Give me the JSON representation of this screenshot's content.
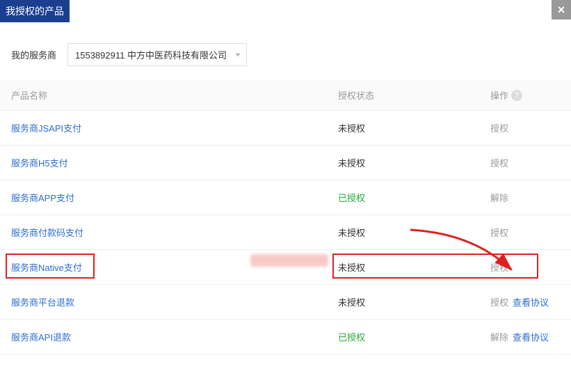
{
  "header": {
    "title": "我授权的产品"
  },
  "filter": {
    "label": "我的服务商",
    "selected": "1553892911 中方中医药科技有限公司"
  },
  "table": {
    "headers": {
      "name": "产品名称",
      "status": "授权状态",
      "action": "操作"
    },
    "help": "?",
    "rows": [
      {
        "name": "服务商JSAPI支付",
        "status": "未授权",
        "status_ok": false,
        "action": "授权",
        "view": ""
      },
      {
        "name": "服务商H5支付",
        "status": "未授权",
        "status_ok": false,
        "action": "授权",
        "view": ""
      },
      {
        "name": "服务商APP支付",
        "status": "已授权",
        "status_ok": true,
        "action": "解除",
        "view": ""
      },
      {
        "name": "服务商付款码支付",
        "status": "未授权",
        "status_ok": false,
        "action": "授权",
        "view": ""
      },
      {
        "name": "服务商Native支付",
        "status": "未授权",
        "status_ok": false,
        "action": "授权",
        "view": "",
        "highlight": true,
        "pink": true
      },
      {
        "name": "服务商平台退款",
        "status": "未授权",
        "status_ok": false,
        "action": "授权",
        "view": "查看协议"
      },
      {
        "name": "服务商API退款",
        "status": "已授权",
        "status_ok": true,
        "action": "解除",
        "view": "查看协议"
      }
    ]
  }
}
